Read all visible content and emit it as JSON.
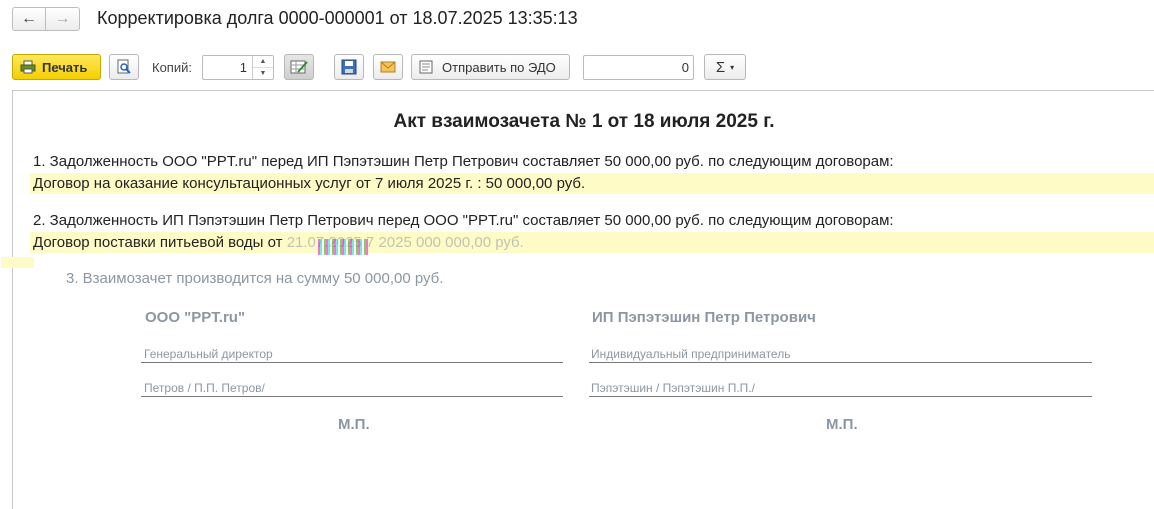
{
  "window": {
    "title": "Корректировка долга 0000-000001 от 18.07.2025 13:35:13",
    "back_icon": "←",
    "forward_icon": "→"
  },
  "toolbar": {
    "print_label": "Печать",
    "copies_label": "Копий:",
    "copies_value": "1",
    "send_edo_label": "Отправить по ЭДО",
    "sum_value": "0",
    "sigma_label": "Σ",
    "sigma_caret": "▾"
  },
  "document": {
    "title": "Акт взаимозачета № 1 от 18 июля 2025 г.",
    "para1": "1. Задолженность ООО \"PPT.ru\" перед ИП Пэпэтэшин Петр Петрович составляет 50 000,00 руб. по следующим договорам:",
    "contract1": "Договор на оказание консультационных услуг от 7 июля 2025 г. : 50 000,00 руб.",
    "para2": "2. Задолженность ИП Пэпэтэшин Петр Петрович перед ООО \"PPT.ru\" составляет 50 000,00 руб. по следующим договорам:",
    "contract2_visible": "Договор поставки питьевой воды от",
    "contract2_faded": "21.07.2025   7 2025  000 000,00 руб.",
    "para3": "3. Взаимозачет производится на сумму 50 000,00 руб.",
    "left_party": {
      "name": "ООО \"PPT.ru\"",
      "position": "Генеральный директор",
      "signature": "Петров / П.П. Петров/",
      "stamp": "М.П."
    },
    "right_party": {
      "name": "ИП Пэпэтэшин Петр Петрович",
      "position": "Индивидуальный предприниматель",
      "signature": "Пэпэтэшин / Пэпэтэшин П.П./",
      "stamp": "М.П."
    }
  },
  "colors": {
    "print_button": "#f4cf00",
    "highlight": "#fffbc6",
    "faded_text": "#8c97a2"
  }
}
